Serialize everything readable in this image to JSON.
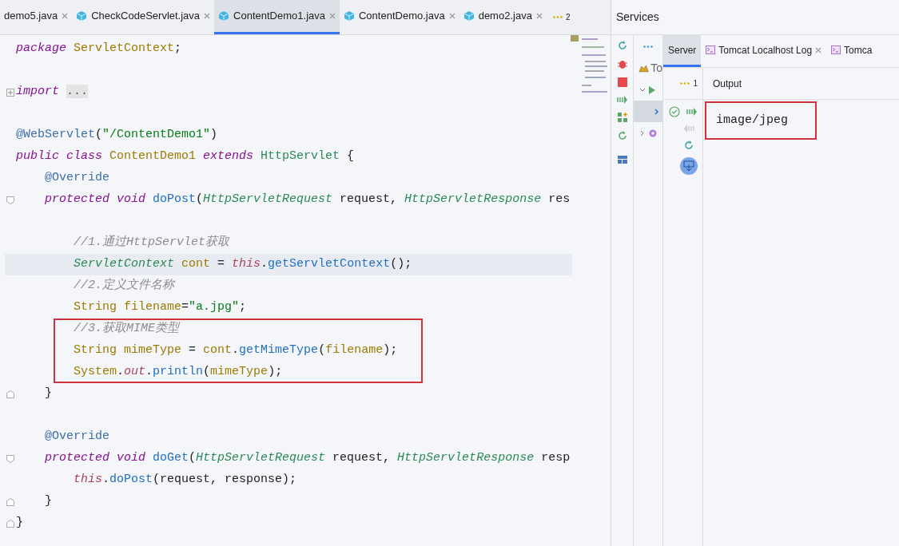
{
  "editor_tabs": [
    {
      "label": "demo5.java",
      "icon": false,
      "selected": false
    },
    {
      "label": "CheckCodeServlet.java",
      "icon": true,
      "selected": false
    },
    {
      "label": "ContentDemo1.java",
      "icon": true,
      "selected": true
    },
    {
      "label": "ContentDemo.java",
      "icon": true,
      "selected": false
    },
    {
      "label": "demo2.java",
      "icon": true,
      "selected": false
    }
  ],
  "tab_overflow_count": "2",
  "code_lines": [
    {
      "kind": "plain",
      "tokens": [
        {
          "kind": "kw",
          "t": "package "
        },
        {
          "kind": "pkg",
          "t": "ServletContext"
        },
        {
          "kind": "plain",
          "t": ";"
        }
      ]
    },
    {
      "kind": "plain"
    },
    {
      "kind": "folded",
      "tokens": [
        {
          "kind": "kw",
          "t": "import "
        },
        {
          "kind": "folded",
          "t": "..."
        }
      ]
    },
    {
      "kind": "plain"
    },
    {
      "kind": "plain",
      "tokens": [
        {
          "kind": "ann",
          "t": "@WebServlet"
        },
        {
          "kind": "plain",
          "t": "("
        },
        {
          "kind": "str",
          "t": "\"/ContentDemo1\""
        },
        {
          "kind": "plain",
          "t": ")"
        }
      ]
    },
    {
      "kind": "plain",
      "tokens": [
        {
          "kind": "kw",
          "t": "public class "
        },
        {
          "kind": "pkg",
          "t": "ContentDemo1 "
        },
        {
          "kind": "kw",
          "t": "extends "
        },
        {
          "kind": "type",
          "t": "HttpServlet "
        },
        {
          "kind": "plain",
          "t": "{"
        }
      ]
    },
    {
      "kind": "plain",
      "tokens": [
        {
          "kind": "ann",
          "t": "    @Override"
        }
      ]
    },
    {
      "kind": "fold-start",
      "tokens": [
        {
          "kind": "kw",
          "t": "    protected void "
        },
        {
          "kind": "method",
          "t": "doPost"
        },
        {
          "kind": "plain",
          "t": "("
        },
        {
          "kind": "itype",
          "t": "HttpServletRequest "
        },
        {
          "kind": "plain",
          "t": "request, "
        },
        {
          "kind": "itype",
          "t": "HttpServletResponse "
        },
        {
          "kind": "plain",
          "t": "res"
        }
      ]
    },
    {
      "kind": "plain"
    },
    {
      "kind": "plain",
      "tokens": [
        {
          "kind": "comment",
          "t": "        //1.通过HttpServlet获取"
        }
      ]
    },
    {
      "kind": "plain",
      "current": true,
      "tokens": [
        {
          "kind": "itype",
          "t": "        ServletContext "
        },
        {
          "kind": "pkg",
          "t": "cont "
        },
        {
          "kind": "plain",
          "t": "= "
        },
        {
          "kind": "this",
          "t": "this"
        },
        {
          "kind": "plain",
          "t": "."
        },
        {
          "kind": "method",
          "t": "getServletContext"
        },
        {
          "kind": "plain",
          "t": "();"
        }
      ]
    },
    {
      "kind": "plain",
      "tokens": [
        {
          "kind": "comment",
          "t": "        //2.定义文件名称"
        }
      ]
    },
    {
      "kind": "plain",
      "tokens": [
        {
          "kind": "pkg",
          "t": "        String filename"
        },
        {
          "kind": "plain",
          "t": "="
        },
        {
          "kind": "str",
          "t": "\"a.jpg\""
        },
        {
          "kind": "plain",
          "t": ";"
        }
      ]
    },
    {
      "kind": "plain",
      "boxed": true,
      "tokens": [
        {
          "kind": "comment",
          "t": "        //3.获取MIME类型"
        }
      ]
    },
    {
      "kind": "plain",
      "boxed": true,
      "tokens": [
        {
          "kind": "pkg",
          "t": "        String mimeType "
        },
        {
          "kind": "plain",
          "t": "= "
        },
        {
          "kind": "pkg",
          "t": "cont"
        },
        {
          "kind": "plain",
          "t": "."
        },
        {
          "kind": "method",
          "t": "getMimeType"
        },
        {
          "kind": "plain",
          "t": "("
        },
        {
          "kind": "pkg",
          "t": "filename"
        },
        {
          "kind": "plain",
          "t": ");"
        }
      ]
    },
    {
      "kind": "plain",
      "boxed": true,
      "tokens": [
        {
          "kind": "pkg",
          "t": "        System"
        },
        {
          "kind": "plain",
          "t": "."
        },
        {
          "kind": "this",
          "t": "out"
        },
        {
          "kind": "plain",
          "t": "."
        },
        {
          "kind": "method",
          "t": "println"
        },
        {
          "kind": "plain",
          "t": "("
        },
        {
          "kind": "pkg",
          "t": "mimeType"
        },
        {
          "kind": "plain",
          "t": ");"
        }
      ]
    },
    {
      "kind": "fold-end",
      "tokens": [
        {
          "kind": "plain",
          "t": "    }"
        }
      ]
    },
    {
      "kind": "plain"
    },
    {
      "kind": "plain",
      "tokens": [
        {
          "kind": "ann",
          "t": "    @Override"
        }
      ]
    },
    {
      "kind": "fold-start",
      "tokens": [
        {
          "kind": "kw",
          "t": "    protected void "
        },
        {
          "kind": "method",
          "t": "doGet"
        },
        {
          "kind": "plain",
          "t": "("
        },
        {
          "kind": "itype",
          "t": "HttpServletRequest "
        },
        {
          "kind": "plain",
          "t": "request, "
        },
        {
          "kind": "itype",
          "t": "HttpServletResponse "
        },
        {
          "kind": "plain",
          "t": "resp"
        }
      ]
    },
    {
      "kind": "plain",
      "tokens": [
        {
          "kind": "this",
          "t": "        this"
        },
        {
          "kind": "plain",
          "t": "."
        },
        {
          "kind": "method",
          "t": "doPost"
        },
        {
          "kind": "plain",
          "t": "(request, response);"
        }
      ]
    },
    {
      "kind": "fold-end",
      "tokens": [
        {
          "kind": "plain",
          "t": "    }"
        }
      ]
    },
    {
      "kind": "fold-end",
      "tokens": [
        {
          "kind": "plain",
          "t": "}"
        }
      ]
    }
  ],
  "services": {
    "title": "Services",
    "tree_items": [
      {
        "kind": "tomcat",
        "label": "To",
        "selected": false
      },
      {
        "kind": "run",
        "selected": false
      },
      {
        "kind": "child",
        "selected": true
      },
      {
        "kind": "config",
        "selected": false
      }
    ],
    "tabs": [
      {
        "label": "Server",
        "icon": false,
        "closable": false,
        "selected": true
      },
      {
        "label": "Tomcat Localhost Log",
        "icon": true,
        "closable": true,
        "selected": false
      },
      {
        "label": "Tomca",
        "icon": true,
        "closable": false,
        "selected": false
      }
    ],
    "counter": "1",
    "output_header": "Output",
    "output_lines": [
      {
        "text": "image/jpeg",
        "boxed": true
      }
    ]
  }
}
